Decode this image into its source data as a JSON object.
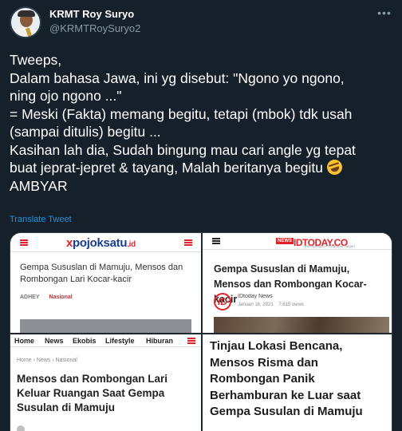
{
  "tweet": {
    "author_name": "KRMT Roy Suryo",
    "author_handle": "@KRMTRoySuryo2",
    "more_icon": "more-dots-icon",
    "lines": [
      "Tweeps,",
      "Dalam bahasa Jawa, ini yg disebut: \"Ngono yo ngono,",
      "ning ojo ngono ...\"",
      "= Meski (Fakta) memang begitu, tetapi (mbok) tdk usah",
      "(sampai ditulis) begitu ...",
      "Kasihan lah dia, Sudah bingung mau cari angle yg tepat",
      "buat jeprat-jepret & tayang, Malah beritanya begitu",
      "AMBYAR"
    ],
    "emoji_icon": "rolling-on-floor-laughing-emoji",
    "translate_label": "Translate Tweet",
    "link_color": "#1b95e0",
    "background_color": "#15202b"
  },
  "media": {
    "pojoksatu": {
      "logo_x": "x",
      "logo_text": "pojoksatu",
      "logo_suffix": ".id",
      "headline": "Gempa Sususlan di Mamuju, Mensos dan Rombongan Lari Kocar-kacir",
      "author": "ADHEY",
      "category": "Nasional"
    },
    "idtoday": {
      "logo_badge": "NEWS",
      "logo_brand": "IDTODAY.CO",
      "tagline": "Membangun Peradaban Negeri",
      "headline": "Gempa Sususlan di Mamuju, Mensos dan Rombongan Kocar-kacir",
      "icon_letter": "ID",
      "source": "IDtoday News",
      "date": "Januari 16, 2021",
      "views": "7.615 views"
    },
    "third": {
      "nav": [
        "Home",
        "News",
        "Ekobis",
        "Lifestyle",
        "Hiburan"
      ],
      "crumbs": "Home  ›  News  ›  Nasional",
      "headline": "Mensos dan Rombongan Lari Keluar Ruangan Saat Gempa Susulan di Mamuju"
    },
    "fourth": {
      "headline": "Tinjau Lokasi Bencana, Mensos Risma dan Rombongan Panik Berhamburan ke Luar saat Gempa Susulan di Mamuju"
    }
  }
}
